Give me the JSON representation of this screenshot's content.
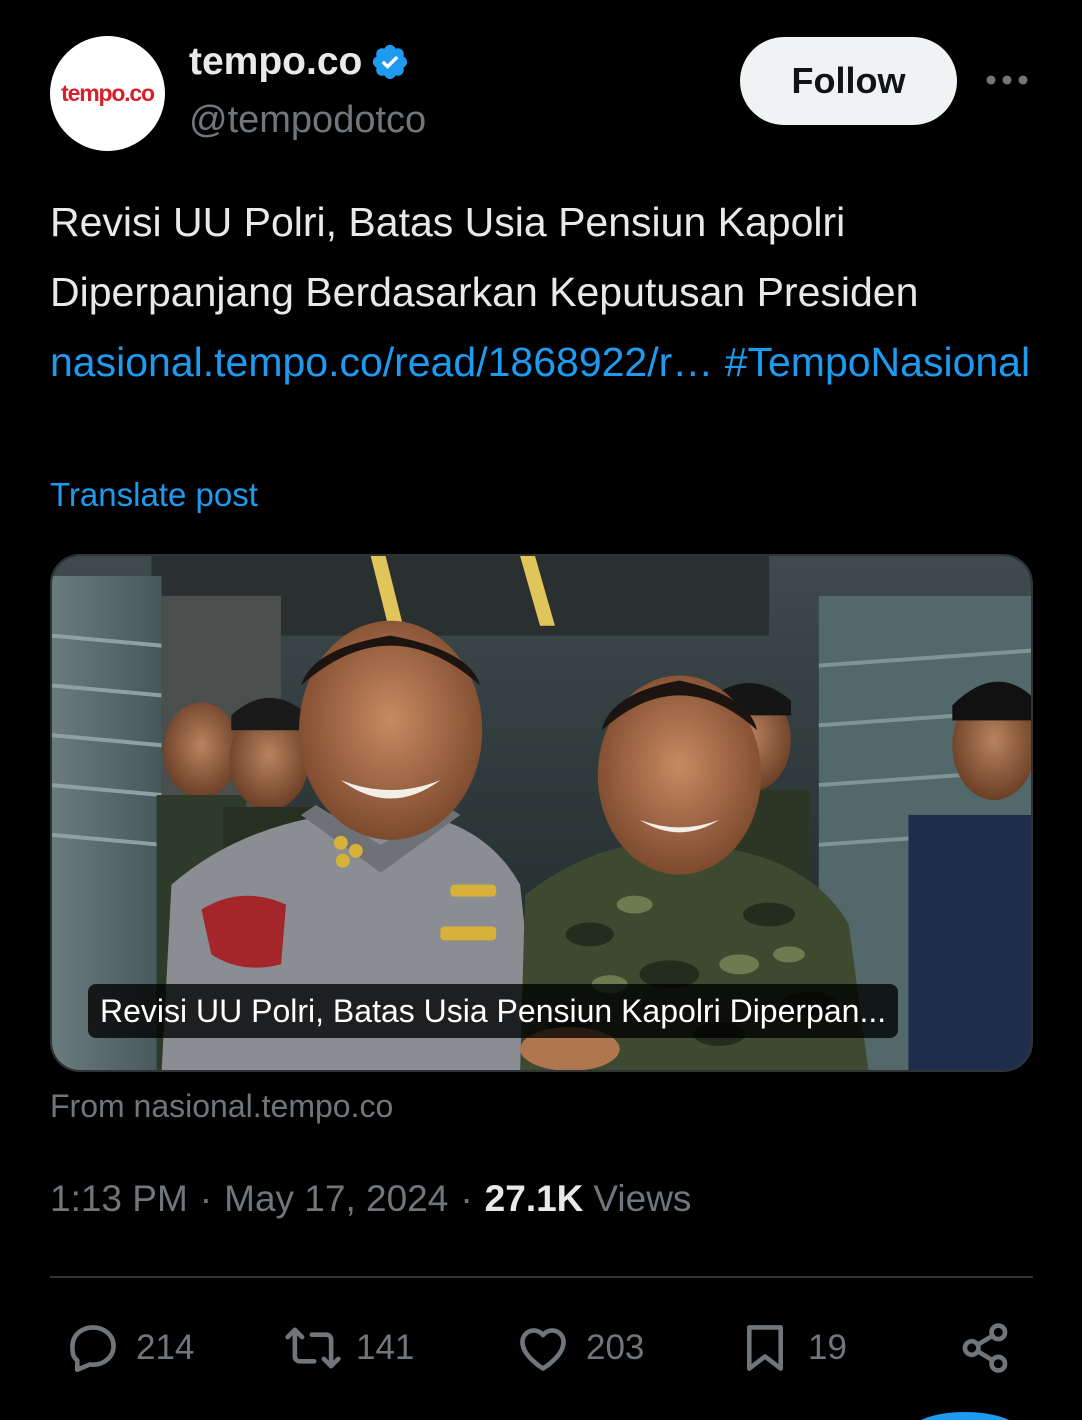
{
  "header": {
    "avatar_text": "tempo.co",
    "display_name": "tempo.co",
    "handle": "@tempodotco",
    "follow_label": "Follow"
  },
  "tweet": {
    "text_plain": "Revisi UU Polri, Batas Usia Pensiun Kapolri Diperpanjang Berdasarkan Keputusan Presiden ",
    "link_text": "nasional.tempo.co/read/1868922/r…",
    "hashtag": "#TempoNasional",
    "translate_label": "Translate post"
  },
  "card": {
    "caption": "Revisi UU Polri, Batas Usia Pensiun Kapolri Diperpan...",
    "source": "From nasional.tempo.co"
  },
  "meta": {
    "time": "1:13 PM",
    "date": "May 17, 2024",
    "views_count": "27.1K",
    "views_label": "Views"
  },
  "actions": {
    "replies": "214",
    "reposts": "141",
    "likes": "203",
    "bookmarks": "19"
  },
  "colors": {
    "accent": "#1d9bf0",
    "brand": "#d6202b",
    "muted": "#71767b",
    "text": "#e7e9ea"
  },
  "icons": [
    "verified-badge-icon",
    "more-icon",
    "reply-icon",
    "repost-icon",
    "like-icon",
    "bookmark-icon",
    "share-icon"
  ]
}
